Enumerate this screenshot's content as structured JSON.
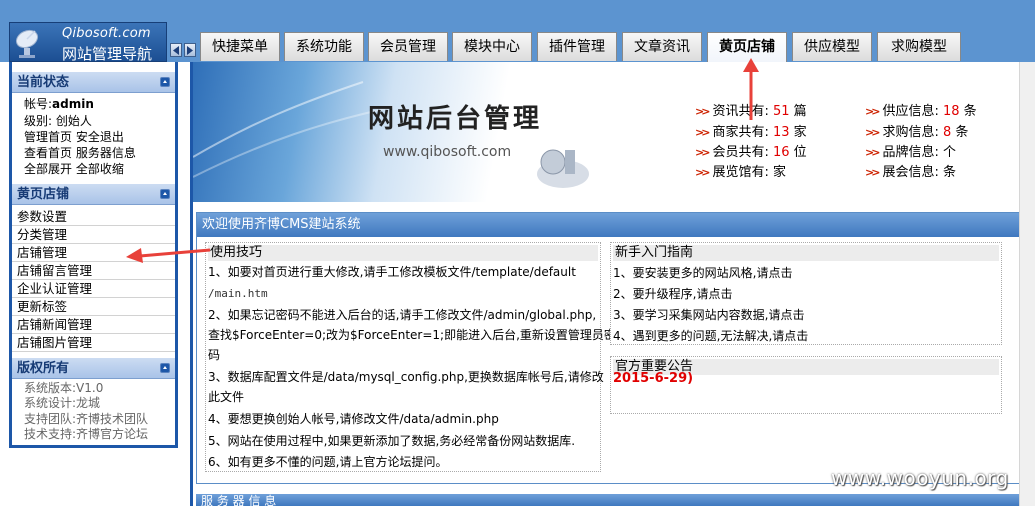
{
  "header": {
    "brand": "Qibosoft.com",
    "nav_title": "网站管理导航",
    "tabs": [
      {
        "label": "快捷菜单",
        "active": false
      },
      {
        "label": "系统功能",
        "active": false
      },
      {
        "label": "会员管理",
        "active": false
      },
      {
        "label": "模块中心",
        "active": false
      },
      {
        "label": "插件管理",
        "active": false
      },
      {
        "label": "文章资讯",
        "active": false
      },
      {
        "label": "黄页店铺",
        "active": true
      },
      {
        "label": "供应模型",
        "active": false
      },
      {
        "label": "求购模型",
        "active": false
      }
    ]
  },
  "sidebar": {
    "status": {
      "title": "当前状态",
      "account_label": "帐号:",
      "account_value": "admin",
      "level_label": "级别:",
      "level_value": "创始人",
      "links_row1": [
        "管理首页",
        "安全退出"
      ],
      "links_row2": [
        "查看首页",
        "服务器信息"
      ],
      "links_row3": [
        "全部展开",
        "全部收缩"
      ]
    },
    "section": {
      "title": "黄页店铺",
      "items": [
        "参数设置",
        "分类管理",
        "店铺管理",
        "店铺留言管理",
        "企业认证管理",
        "更新标签",
        "店铺新闻管理",
        "店铺图片管理"
      ]
    },
    "copyright": {
      "title": "版权所有",
      "lines": [
        "系统版本:V1.0",
        "系统设计:龙城",
        "支持团队:齐博技术团队",
        "技术支持:齐博官方论坛"
      ]
    }
  },
  "banner": {
    "title": "网站后台管理",
    "url": "www.qibosoft.com"
  },
  "stats": {
    "left": [
      {
        "label": "资讯共有:",
        "value": "51",
        "unit": "篇"
      },
      {
        "label": "商家共有:",
        "value": "13",
        "unit": "家"
      },
      {
        "label": "会员共有:",
        "value": "16",
        "unit": "位"
      },
      {
        "label": "展览馆有:",
        "value": "",
        "unit": "家"
      }
    ],
    "right": [
      {
        "label": "供应信息:",
        "value": "18",
        "unit": "条"
      },
      {
        "label": "求购信息:",
        "value": "8",
        "unit": "条"
      },
      {
        "label": "品牌信息:",
        "value": "",
        "unit": "个"
      },
      {
        "label": "展会信息:",
        "value": "",
        "unit": "条"
      }
    ]
  },
  "welcome": {
    "title": "欢迎使用齐博CMS建站系统",
    "tips": {
      "title": "使用技巧",
      "lines": [
        "1、如要对首页进行重大修改,请手工修改模板文件/template/default",
        "/main.htm",
        "2、如果忘记密码不能进入后台的话,请手工修改文件/admin/global.php,",
        "查找$ForceEnter=0;改为$ForceEnter=1;即能进入后台,重新设置管理员密",
        "码",
        "3、数据库配置文件是/data/mysql_config.php,更换数据库帐号后,请修改",
        "此文件",
        "4、要想更换创始人帐号,请修改文件/data/admin.php",
        "5、网站在使用过程中,如果更新添加了数据,务必经常备份网站数据库.",
        "6、如有更多不懂的问题,请上官方论坛提问。"
      ]
    },
    "guide": {
      "title": "新手入门指南",
      "lines": [
        "1、要安装更多的网站风格,请点击",
        "2、要升级程序,请点击",
        "3、要学习采集网站内容数据,请点击",
        "4、遇到更多的问题,无法解决,请点击"
      ]
    },
    "notice": {
      "title": "官方重要公告",
      "date": "2015-6-29)"
    }
  },
  "bottom_bar": {
    "label": "服 务 器 信 息"
  },
  "watermark": "www.wooyun.org",
  "colors": {
    "header_blue": "#5c94d0",
    "sidebar_border": "#1d57a8",
    "panel_bar": "#3f78bf",
    "highlight_red": "#e00000",
    "annotation_red": "#e8413a"
  }
}
